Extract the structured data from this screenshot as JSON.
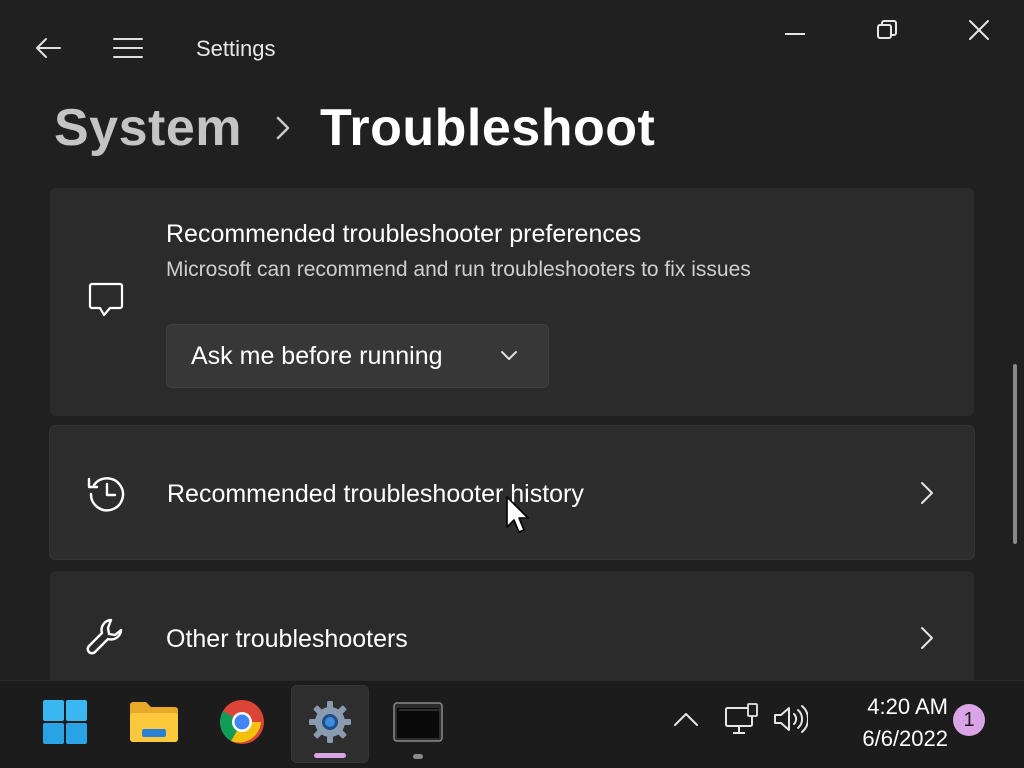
{
  "window": {
    "app_title": "Settings",
    "controls": {
      "back_icon": "back-arrow-icon",
      "menu_icon": "hamburger-menu-icon",
      "minimize_icon": "minimize-icon",
      "maximize_icon": "restore-icon",
      "close_icon": "close-icon"
    }
  },
  "breadcrumb": {
    "parent": "System",
    "separator_icon": "chevron-right-icon",
    "current": "Troubleshoot"
  },
  "cards": {
    "preferences": {
      "icon": "chat-bubble-icon",
      "title": "Recommended troubleshooter preferences",
      "subtitle": "Microsoft can recommend and run troubleshooters to fix issues",
      "dropdown": {
        "selected": "Ask me before running",
        "icon": "chevron-down-icon"
      }
    },
    "history": {
      "icon": "history-icon",
      "title": "Recommended troubleshooter history",
      "chevron_icon": "chevron-right-icon"
    },
    "other": {
      "icon": "wrench-icon",
      "title": "Other troubleshooters",
      "chevron_icon": "chevron-right-icon"
    }
  },
  "taskbar": {
    "apps": [
      {
        "name": "Start",
        "icon": "windows-start-icon"
      },
      {
        "name": "File Explorer",
        "icon": "folder-icon"
      },
      {
        "name": "Google Chrome",
        "icon": "chrome-icon"
      },
      {
        "name": "Settings",
        "icon": "settings-gear-icon",
        "active": true
      },
      {
        "name": "Terminal",
        "icon": "terminal-icon",
        "running": true
      }
    ],
    "tray": {
      "overflow_icon": "chevron-up-icon",
      "network_icon": "network-icon",
      "volume_icon": "volume-icon"
    },
    "time": "4:20 AM",
    "date": "6/6/2022",
    "notification_count": "1"
  },
  "colors": {
    "background": "#202020",
    "card": "#2b2b2b",
    "accent_indicator": "#d9a5e6",
    "notification_badge": "#d9a5e6"
  }
}
